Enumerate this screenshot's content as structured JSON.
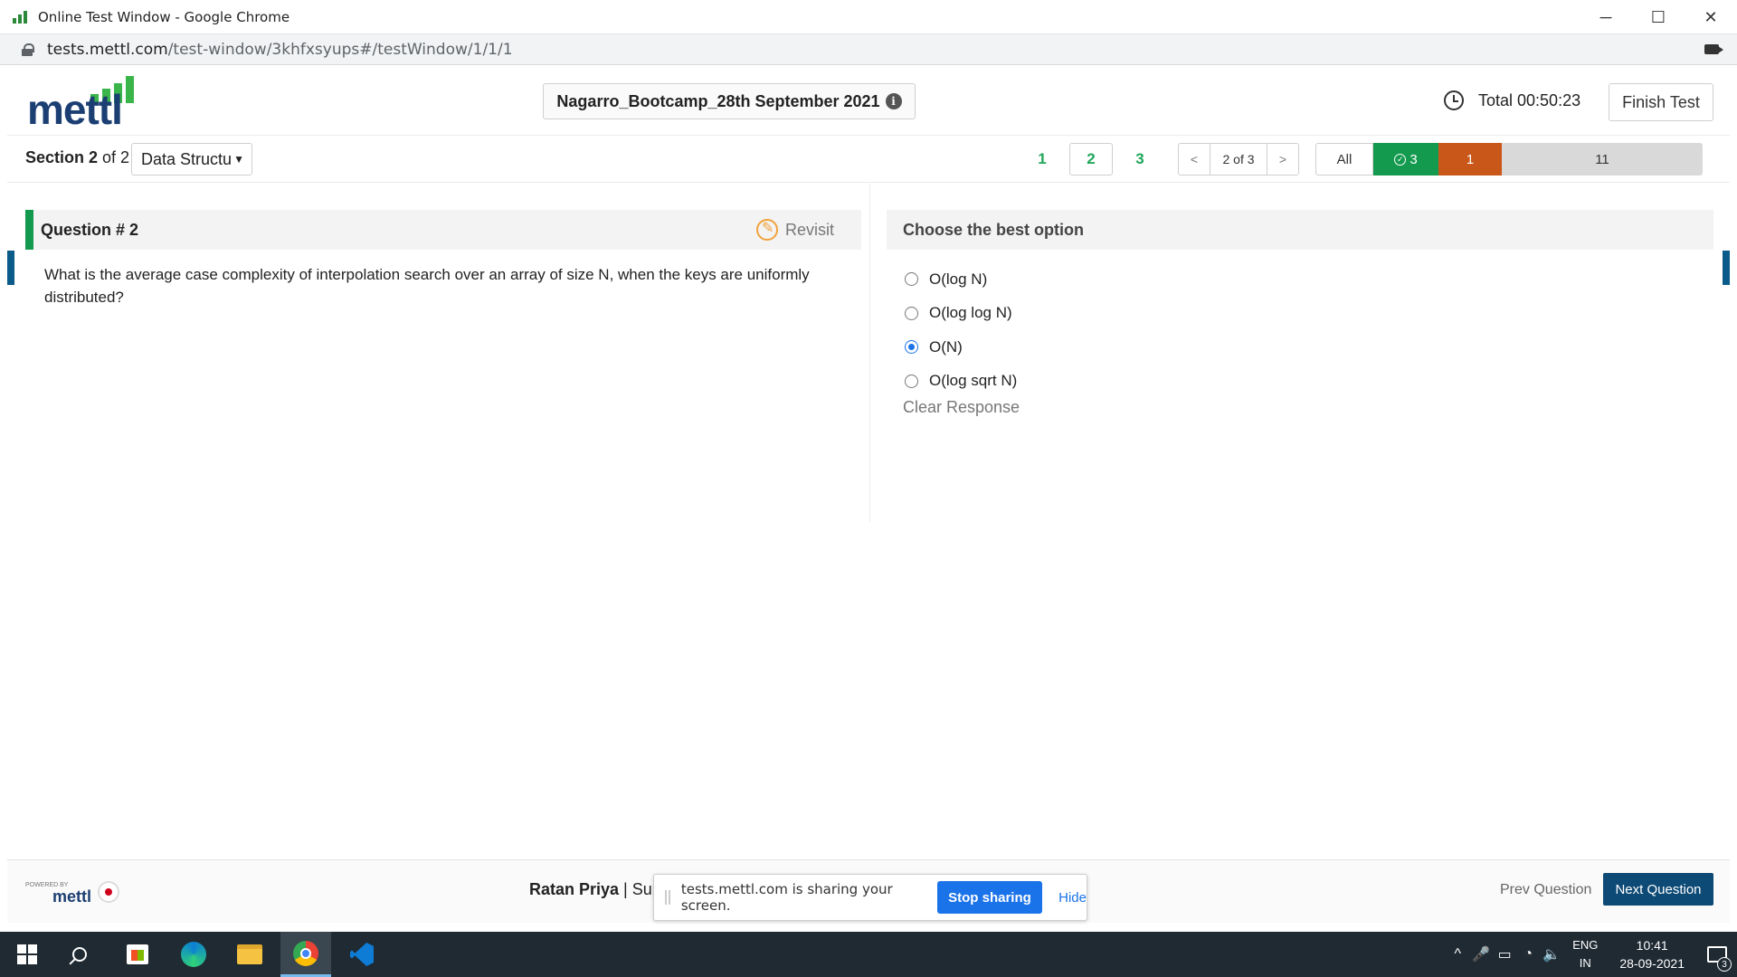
{
  "browser": {
    "window_title": "Online Test Window - Google Chrome",
    "url_host": "tests.mettl.com",
    "url_path": "/test-window/3khfxsyups#/testWindow/1/1/1",
    "controls": {
      "minimize": "─",
      "maximize": "☐",
      "close": "✕"
    }
  },
  "header": {
    "logo_text": "mettl",
    "test_name": "Nagarro_Bootcamp_28th September 2021",
    "info_icon": "i",
    "timer_label": "Total 00:50:23",
    "finish_label": "Finish Test"
  },
  "section_bar": {
    "section_bold": "Section 2",
    "section_rest": " of 2",
    "section_select": "Data Structu",
    "question_numbers": [
      "1",
      "2",
      "3"
    ],
    "pager_prev": "<",
    "pager_text": "2 of 3",
    "pager_next": ">",
    "filters": {
      "all": "All",
      "answered": "3",
      "revisit": "1",
      "unanswered": "11"
    }
  },
  "question": {
    "title": "Question # 2",
    "revisit_label": "Revisit",
    "text": "What is the average case complexity of interpolation search over an array of size N, when the keys are uniformly distributed?"
  },
  "answer": {
    "header": "Choose the best option",
    "options": [
      {
        "label": "O(log N)",
        "selected": false
      },
      {
        "label": "O(log log N)",
        "selected": false
      },
      {
        "label": "O(N)",
        "selected": true
      },
      {
        "label": "O(log sqrt N)",
        "selected": false
      }
    ],
    "clear_label": "Clear Response"
  },
  "footer": {
    "powered_by": "POWERED BY",
    "powered_word": "mettl",
    "user_name": "Ratan Priya",
    "user_rest": " | Sup",
    "prev_label": "Prev Question",
    "next_label": "Next Question"
  },
  "share_bar": {
    "message": "tests.mettl.com is sharing your screen.",
    "stop_label": "Stop sharing",
    "hide_label": "Hide"
  },
  "taskbar": {
    "lang_top": "ENG",
    "lang_bottom": "IN",
    "time": "10:41",
    "date": "28-09-2021",
    "notification_count": "3",
    "tray_chevron": "^",
    "tray_mic": "🎤",
    "tray_battery": "▭",
    "tray_wifi": "◔",
    "tray_volume": "🔈"
  },
  "colors": {
    "answered": "#149a4e",
    "revisit": "#c9571a",
    "unanswered": "#d9d9d9",
    "next_button": "#0d4a75",
    "accent_blue": "#1a73e8"
  }
}
